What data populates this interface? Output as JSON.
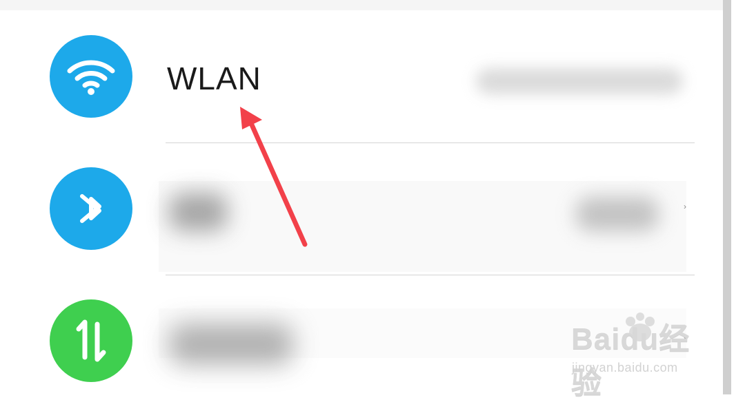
{
  "colors": {
    "wifi_icon_bg": "#1da9ea",
    "bluetooth_icon_bg": "#1da9ea",
    "mobile_data_icon_bg": "#3fcf4f",
    "annotation_arrow": "#f2414a",
    "divider": "#d4d4d4",
    "title_text": "#1a1a1a"
  },
  "rows": {
    "wlan": {
      "title": "WLAN",
      "icon": "wifi-icon",
      "value": ""
    },
    "bluetooth": {
      "title": "",
      "icon": "bluetooth-icon",
      "value": ""
    },
    "mobile_data": {
      "title": "",
      "icon": "mobile-data-icon",
      "value": ""
    }
  },
  "annotation": {
    "type": "arrow",
    "points_to": "WLAN"
  },
  "watermark": {
    "brand": "Baidu经验",
    "url": "jingyan.baidu.com"
  }
}
